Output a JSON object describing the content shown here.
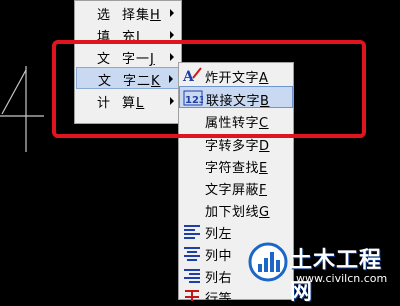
{
  "main_menu": {
    "items": [
      {
        "c1": "选",
        "c2": "择集",
        "key": "H",
        "has_submenu": true
      },
      {
        "c1": "填",
        "c2": "充",
        "key": "I",
        "has_submenu": true
      },
      {
        "c1": "文",
        "c2": "字一",
        "key": "J",
        "has_submenu": true
      },
      {
        "c1": "文",
        "c2": "字二",
        "key": "K",
        "has_submenu": true,
        "selected": true
      },
      {
        "c1": "计",
        "c2": "算",
        "key": "L",
        "has_submenu": true
      }
    ]
  },
  "sub_menu": {
    "items": [
      {
        "label": "炸开文字",
        "key": "A",
        "icon": "explode-text-icon"
      },
      {
        "label": "联接文字",
        "key": "B",
        "icon": "join-text-123-icon",
        "selected": true
      },
      {
        "label": "属性转字",
        "key": "C"
      },
      {
        "label": "字转多字",
        "key": "D"
      },
      {
        "label": "字符查找",
        "key": "E"
      },
      {
        "label": "文字屏蔽",
        "key": "F"
      },
      {
        "label": "加下划线",
        "key": "G"
      },
      {
        "label": "列左",
        "icon": "align-left-icon"
      },
      {
        "label": "列中",
        "icon": "align-center-icon"
      },
      {
        "label": "列右",
        "icon": "align-right-icon"
      },
      {
        "label": "行等",
        "icon": "row-equal-icon"
      }
    ]
  },
  "watermark": {
    "title": "土木工程网",
    "url": "www.civilcn.com"
  },
  "colors": {
    "highlight_box": "#e0141e",
    "menu_bg": "#f0f0f0",
    "selection_bg": "#c9d9f2",
    "canvas_bg": "#000000"
  }
}
